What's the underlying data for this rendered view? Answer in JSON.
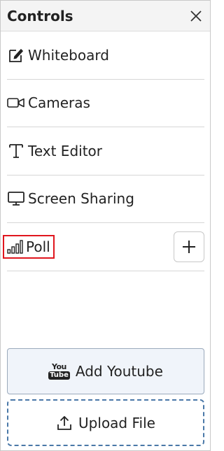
{
  "header": {
    "title": "Controls"
  },
  "items": [
    {
      "label": "Whiteboard",
      "icon": "edit-icon"
    },
    {
      "label": "Cameras",
      "icon": "camera-icon"
    },
    {
      "label": "Text Editor",
      "icon": "text-icon"
    },
    {
      "label": "Screen Sharing",
      "icon": "monitor-icon"
    },
    {
      "label": "Poll",
      "icon": "poll-icon"
    }
  ],
  "buttons": {
    "youtube": {
      "label": "Add Youtube",
      "icon_top": "You",
      "icon_bottom": "Tube"
    },
    "upload": {
      "label": "Upload File"
    }
  },
  "colors": {
    "highlight": "#e0161e",
    "upload_border": "#4a78a8"
  }
}
